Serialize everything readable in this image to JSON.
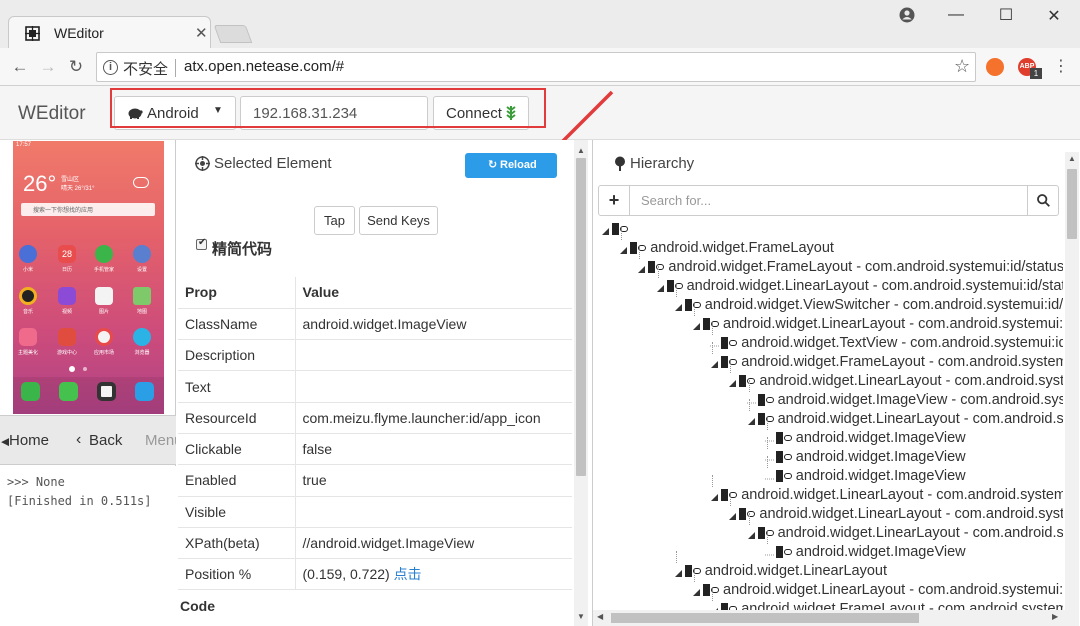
{
  "browser": {
    "tab_title": "WEditor",
    "insecure_label": "不安全",
    "url": "atx.open.netease.com/#",
    "ext_badge": "ABP",
    "ext_count": "1"
  },
  "header": {
    "brand": "WEditor",
    "platform": "Android",
    "ip": "192.168.31.234",
    "connect": "Connect"
  },
  "phone": {
    "time": "17:57",
    "temperature": "26°",
    "weather_city": "雪山区",
    "weather_desc": "晴天 26°/31°",
    "search_placeholder": "搜索一下你想找的应用",
    "apps": [
      "小米",
      "日历",
      "手机管家",
      "设置",
      "音乐",
      "视频",
      "图片",
      "地图",
      "主题美化",
      "游戏中心",
      "应用市场",
      "浏览器"
    ],
    "calendar_day": "28",
    "home": "Home",
    "back": "Back",
    "menu": "Menu"
  },
  "console": {
    "line1": ">>> None",
    "line2": "[Finished in 0.511s]"
  },
  "selected": {
    "title": "Selected Element",
    "reload": "Reload",
    "tap": "Tap",
    "send_keys": "Send Keys",
    "simplify": "精简代码",
    "col_prop": "Prop",
    "col_value": "Value",
    "rows": [
      {
        "k": "ClassName",
        "v": "android.widget.ImageView"
      },
      {
        "k": "Description",
        "v": ""
      },
      {
        "k": "Text",
        "v": ""
      },
      {
        "k": "ResourceId",
        "v": "com.meizu.flyme.launcher:id/app_icon"
      },
      {
        "k": "Clickable",
        "v": "false"
      },
      {
        "k": "Enabled",
        "v": "true"
      },
      {
        "k": "Visible",
        "v": ""
      },
      {
        "k": "XPath(beta)",
        "v": "//android.widget.ImageView"
      },
      {
        "k": "Position %",
        "v": "(0.159, 0.722)",
        "link": "点击"
      }
    ],
    "code_label": "Code"
  },
  "hierarchy": {
    "title": "Hierarchy",
    "search_placeholder": "Search for...",
    "nodes": [
      {
        "label": ""
      },
      {
        "label": "android.widget.FrameLayout"
      },
      {
        "label": "android.widget.FrameLayout - com.android.systemui:id/status_bar"
      },
      {
        "label": "android.widget.LinearLayout - com.android.systemui:id/status_bar_contents"
      },
      {
        "label": "android.widget.ViewSwitcher - com.android.systemui:id/ticker"
      },
      {
        "label": "android.widget.LinearLayout - com.android.systemui:id/system_icons"
      },
      {
        "label": "android.widget.TextView - com.android.systemui:id/clock"
      },
      {
        "label": "android.widget.FrameLayout - com.android.systemui:id/signal"
      },
      {
        "label": "android.widget.LinearLayout - com.android.systemui:id/signal_group"
      },
      {
        "label": "android.widget.ImageView - com.android.systemui:id/wifi"
      },
      {
        "label": "android.widget.LinearLayout - com.android.systemui:id/mobile"
      },
      {
        "label": "android.widget.ImageView"
      },
      {
        "label": "android.widget.ImageView"
      },
      {
        "label": "android.widget.ImageView"
      },
      {
        "label": "android.widget.LinearLayout - com.android.systemui:id/battery_group"
      },
      {
        "label": "android.widget.LinearLayout - com.android.systemui:id/battery"
      },
      {
        "label": "android.widget.LinearLayout - com.android.systemui:id/battery_level"
      },
      {
        "label": "android.widget.ImageView"
      },
      {
        "label": "android.widget.LinearLayout"
      },
      {
        "label": "android.widget.LinearLayout - com.android.systemui:id/notification"
      },
      {
        "label": "android.widget.FrameLayout - com.android.systemui:id/notification_icon"
      }
    ]
  },
  "colors": {
    "reload_bg": "#2d9ce8",
    "highlight": "#e23b3b",
    "link": "#2a7fd1"
  }
}
